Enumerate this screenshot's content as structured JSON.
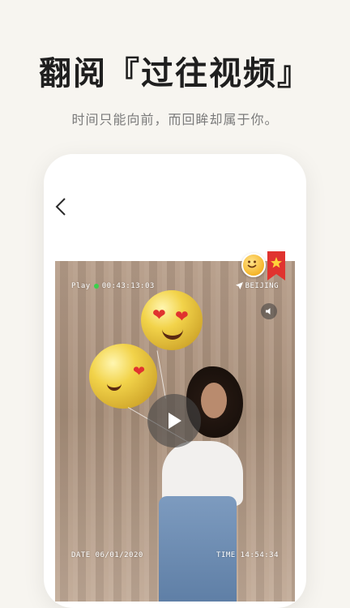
{
  "headline": "翻阅『过往视频』",
  "subline": "时间只能向前，而回眸却属于你。",
  "video": {
    "play_label": "Play",
    "play_time": "00:43:13:03",
    "location": "BEIJING",
    "date": "DATE 06/01/2020",
    "time": "TIME 14:54:34"
  },
  "icons": {
    "back": "chevron-left-icon",
    "location": "navigation-arrow-icon",
    "mute": "speaker-icon",
    "play": "play-icon",
    "emoji": "smiley-emoji-icon",
    "bookmark": "star-ribbon-icon"
  },
  "colors": {
    "background": "#f7f5f0",
    "headline": "#1f1f1f",
    "subline": "#7a7a7a",
    "rec_dot": "#3ad14b",
    "ribbon": "#e0332f"
  }
}
